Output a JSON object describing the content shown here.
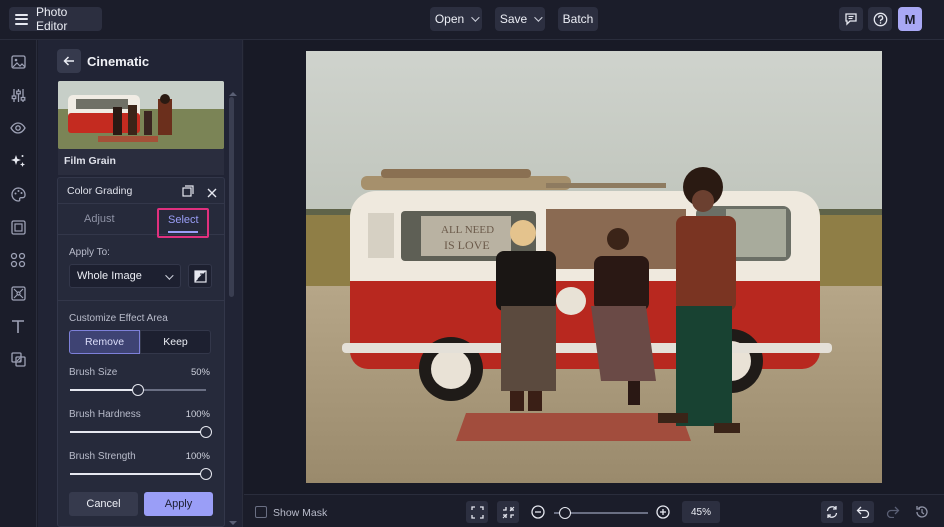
{
  "app": {
    "title": "Photo Editor",
    "user_initial": "M"
  },
  "header": {
    "open_label": "Open",
    "save_label": "Save",
    "batch_label": "Batch"
  },
  "sidebar": {
    "tools": [
      "image-icon",
      "sliders-icon",
      "eye-icon",
      "sparkle-effects-icon",
      "palette-icon",
      "frame-icon",
      "shapes-icon",
      "texture-icon",
      "text-icon",
      "overlay-icon"
    ]
  },
  "panel": {
    "title": "Cinematic",
    "effect_name": "Film Grain",
    "section_title": "Color Grading",
    "tabs": {
      "adjust": "Adjust",
      "select": "Select",
      "active": "Select"
    },
    "apply_to_label": "Apply To:",
    "apply_to_value": "Whole Image",
    "customize_label": "Customize Effect Area",
    "mode_remove": "Remove",
    "mode_keep": "Keep",
    "sliders": [
      {
        "label": "Brush Size",
        "display": "50%",
        "value": 0.5
      },
      {
        "label": "Brush Hardness",
        "display": "100%",
        "value": 1.0
      },
      {
        "label": "Brush Strength",
        "display": "100%",
        "value": 1.0
      }
    ],
    "cancel_label": "Cancel",
    "apply_label": "Apply"
  },
  "bottom": {
    "show_mask_label": "Show Mask",
    "zoom_label": "45%",
    "zoom_value": 0.45
  },
  "colors": {
    "accent": "#9a9ef7",
    "highlight": "#e0307e",
    "van_red": "#b8281f"
  }
}
